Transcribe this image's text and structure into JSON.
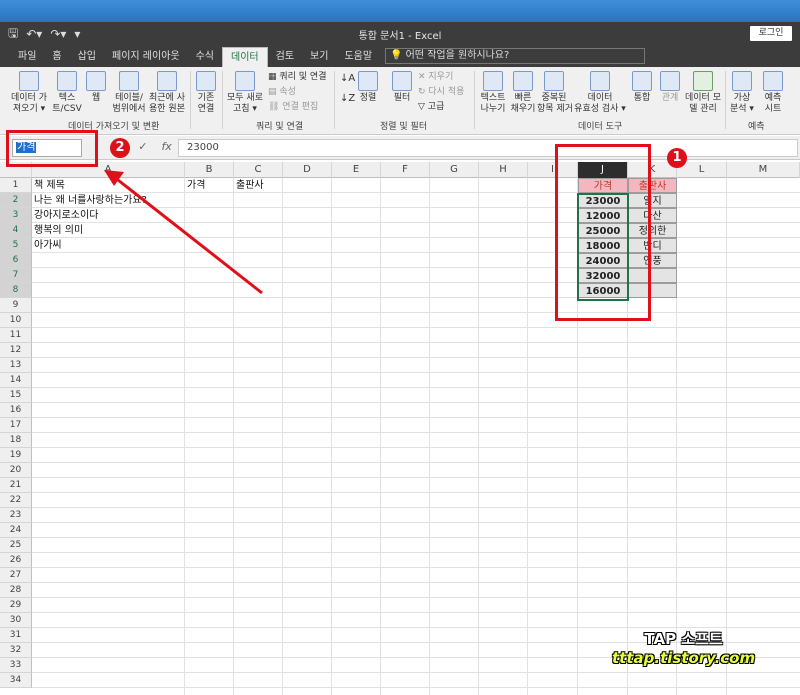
{
  "window": {
    "title": "통합 문서1  -  Excel",
    "login_label": "로그인"
  },
  "qat": {
    "save_icon": "save-icon",
    "undo_icon": "undo-icon",
    "redo_icon": "redo-icon"
  },
  "tabs": [
    "파일",
    "홈",
    "삽입",
    "페이지 레이아웃",
    "수식",
    "데이터",
    "검토",
    "보기",
    "도움말"
  ],
  "tell_me": "어떤 작업을 원하시나요?",
  "ribbon": {
    "get_data": "데이터 가\n져오기 ▾",
    "text_csv": "텍스\n트/CSV",
    "web": "웹",
    "table_range": "테이블/\n범위에서",
    "recent_sources": "최근에 사\n용한 원본",
    "existing_conn": "기존\n연결",
    "refresh_all": "모두 새로\n고침 ▾",
    "queries_conn": "쿼리 및 연결",
    "properties": "속성",
    "edit_links": "연결 편집",
    "sort_asc": "↓",
    "sort": "정렬",
    "filter": "필터",
    "clear": "지우기",
    "reapply": "다시 적용",
    "advanced": "고급",
    "text_to_cols": "텍스트\n나누기",
    "flash_fill": "빠른\n채우기",
    "remove_dup": "중복된\n항목 제거",
    "data_validation": "데이터\n유효성 검사 ▾",
    "consolidate": "통합",
    "relationships": "관계",
    "data_model": "데이터 모\n델 관리",
    "what_if": "가상\n분석 ▾",
    "forecast": "예측\n시트",
    "group_get": "데이터 가져오기 및 변환",
    "group_query": "쿼리 및 연결",
    "group_sort": "정렬 및 필터",
    "group_tools": "데이터 도구",
    "group_forecast": "예측"
  },
  "formula_bar": {
    "name_box": "가격",
    "value": "23000",
    "fx": "fx"
  },
  "columns": [
    "A",
    "B",
    "C",
    "D",
    "E",
    "F",
    "G",
    "H",
    "I",
    "J",
    "K",
    "L",
    "M"
  ],
  "rows": [
    "1",
    "2",
    "3",
    "4",
    "5",
    "6",
    "7",
    "8",
    "9",
    "10",
    "11",
    "12",
    "13",
    "14",
    "15",
    "16",
    "17",
    "18",
    "19",
    "20",
    "21",
    "22",
    "23",
    "24",
    "25",
    "26",
    "27",
    "28",
    "29",
    "30",
    "31",
    "32",
    "33",
    "34"
  ],
  "cells": {
    "a1": "책 제목",
    "b1": "가격",
    "c1": "출판사",
    "a2": "나는 왜 너를사랑하는가요?",
    "a3": "강아지로소이다",
    "a4": "행복의 의미",
    "a5": "아가씨"
  },
  "j_header": "가격",
  "k_header": "출판사",
  "j_values": [
    "23000",
    "12000",
    "25000",
    "18000",
    "24000",
    "32000",
    "16000"
  ],
  "k_values": [
    "일지",
    "다산",
    "정의한",
    "반디",
    "연풍",
    "",
    ""
  ],
  "annotations": {
    "badge1": "1",
    "badge2": "2",
    "accent_color": "#e0101a"
  },
  "watermark": {
    "line1": "TAP 소프트",
    "line2": "tttap.tistory.com"
  }
}
